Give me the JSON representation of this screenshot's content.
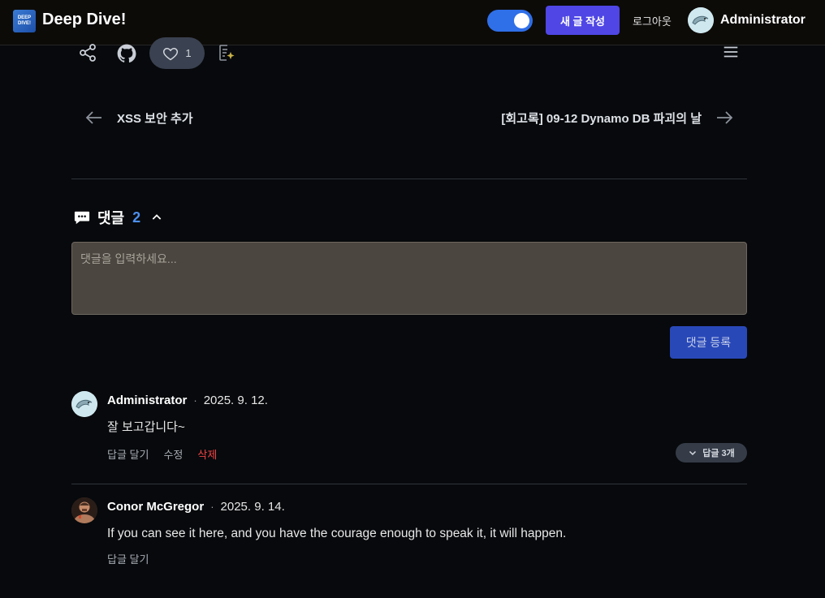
{
  "header": {
    "logo_text": "DEEP DIVE!",
    "site_name": "Deep Dive!",
    "new_post_label": "새 글 작성",
    "logout_label": "로그아웃",
    "user_name": "Administrator"
  },
  "post_actions": {
    "like_count": "1"
  },
  "post_nav": {
    "prev_title": "XSS 보안 추가",
    "next_title": "[회고록] 09-12 Dynamo DB 파괴의 날"
  },
  "comments": {
    "title": "댓글",
    "count": "2",
    "input_placeholder": "댓글을 입력하세요...",
    "submit_label": "댓글 등록",
    "items": [
      {
        "author": "Administrator",
        "date": "2025. 9. 12.",
        "body": "잘 보고갑니다~",
        "reply_label": "답글 달기",
        "edit_label": "수정",
        "delete_label": "삭제",
        "replies_toggle": "답글 3개"
      },
      {
        "author": "Conor McGregor",
        "date": "2025. 9. 14.",
        "body": "If you can see it here, and you have the courage enough to speak it, it will happen.",
        "reply_label": "답글 달기"
      }
    ]
  },
  "colors": {
    "accent": "#4f46e5",
    "toggle": "#2f6fe8",
    "count": "#4d8fee",
    "danger": "#ef4444",
    "background": "#07090c"
  }
}
